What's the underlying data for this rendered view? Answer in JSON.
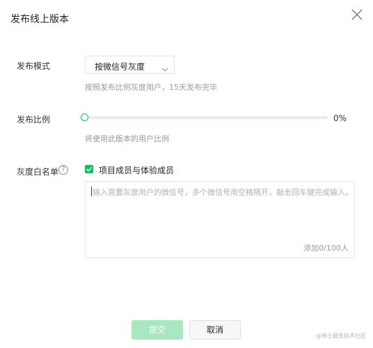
{
  "dialog": {
    "title": "发布线上版本"
  },
  "form": {
    "mode": {
      "label": "发布模式",
      "selected": "按微信号灰度",
      "hint": "按照发布比例灰度用户，15天发布完毕"
    },
    "ratio": {
      "label": "发布比例",
      "value_text": "0%",
      "value": 0,
      "hint": "将使用此版本的用户比例"
    },
    "whitelist": {
      "label": "灰度白名单",
      "help_icon_text": "?",
      "checkbox_label": "项目成员与体验成员",
      "checked": true,
      "placeholder": "输入需要灰度用户的微信号，多个微信号用空格隔开，敲击回车键完成输入。",
      "counter": "添加0/100人"
    }
  },
  "footer": {
    "submit_label": "提交",
    "cancel_label": "取消"
  },
  "watermark": "@稀土掘金技术社区",
  "colors": {
    "accent": "#07c160",
    "submit_disabled_bg": "#a8e7c0"
  },
  "icons": {
    "close": "close-icon",
    "chevron": "chevron-down-icon",
    "help": "help-icon",
    "check": "check-icon"
  }
}
